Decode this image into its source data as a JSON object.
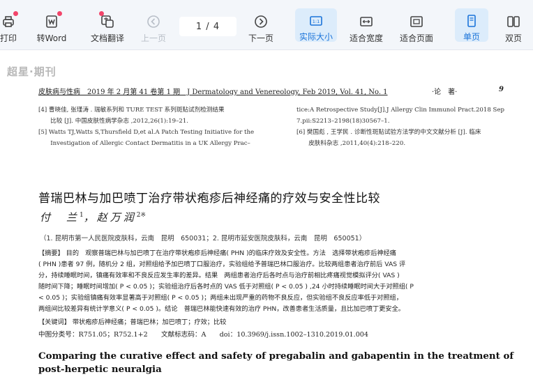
{
  "toolbar": {
    "print_label": "打印",
    "word_label": "转Word",
    "translate_label": "文档翻译",
    "prev_label": "上一页",
    "page_indicator": "1  /  4",
    "next_label": "下一页",
    "actual_size_label": "实际大小",
    "fit_width_label": "适合宽度",
    "fit_page_label": "适合页面",
    "single_page_label": "单页",
    "double_page_label": "双页",
    "accent_color": "#1a73d9",
    "badge_color": "#f2456a"
  },
  "document": {
    "watermark": "超星·期刊",
    "running_head": {
      "journal": "皮肤病与性病　2019 年 2 月第 41 卷第 1 期　J Dermatology and Venereology, Feb 2019, Vol. 41, No. 1",
      "section": "·论　著·",
      "page": "9"
    },
    "references_left": [
      "[4] 曹晓佳, 张瑾涛 . 瑞敏系列和 TURE TEST 系列斑贴试剂检测结果",
      "　　比较 [J]. 中国皮肤性病学杂志 ,2012,26(1):19–21.",
      "[5] Watts TJ,Watts S,Thursfield D,et al.A Patch Testing Initiative for the",
      "　　Investigation of Allergic Contact Dermatitis in a UK Allergy Prac–"
    ],
    "references_right": [
      "tice:A Retrospective Study[J].J Allergy Clin Immunol Pract.2018 Sep",
      "7.pii:S2213–2198(18)30567–1.",
      "[6] 樊国彪 , 王学民 . 诊断性斑贴试验方法学的中文文献分析 [J]. 临床",
      "　　皮肤科杂志 ,2011,40(4):218–220."
    ],
    "title": "普瑞巴林与加巴喷丁治疗带状疱疹后神经痛的疗效与安全性比较",
    "authors": {
      "author1": "付　兰",
      "author1_sup": "1",
      "separator": "，",
      "author2": "赵万润",
      "author2_sup": "2※"
    },
    "affiliation": "（1. 昆明市第一人民医院皮肤科，云南　昆明　650031；2. 昆明市延安医院皮肤科，云南　昆明　650051）",
    "abstract_lines": [
      "【摘要】 目的　观察普瑞巴林与加巴喷丁在治疗带状疱疹后神经痛( PHN )的临床疗效及安全性。方法　选择带状疱疹后神经痛",
      "( PHN )患者 97 例，随机分 2 组，对照组给予加巴喷丁口服治疗，实验组给予普瑞巴林口服治疗。比较两组患者治疗前后 VAS 评",
      "分，持续睡眠时间，镇痛有效率和不良反应发生率的差异。结果　两组患者治疗后各时点与治疗前相比疼痛视觉模拟评分( VAS )",
      "随时间下降；睡眠时间增加( P < 0.05 )；实验组治疗后各时点的 VAS 低于对照组( P < 0.05 ) ,24 小时持续睡眠时间大于对照组( P",
      "< 0.05 )；实验组镇痛有效率显著高于对照组( P < 0.05 )；两组未出现严重的药物不良反应，但实验组不良反应率低于对照组，",
      "两组间比较差异有统计学意义( P < 0.05 )。结论　普瑞巴林能快速有效的治疗 PHN，改善患者生活质量，且比加巴喷丁更安全。"
    ],
    "keywords": "【关键词】 带状疱疹后神经痛；普瑞巴林；加巴喷丁；疗效；比较",
    "classification": "中图分类号：R751.05；R752.1+2　　文献标志码：A　　doi：10.3969/j.issn.1002–1310.2019.01.004",
    "english_title": "Comparing the curative effect and safety of pregabalin and gabapentin in the treatment of post-herpetic neuralgia"
  }
}
